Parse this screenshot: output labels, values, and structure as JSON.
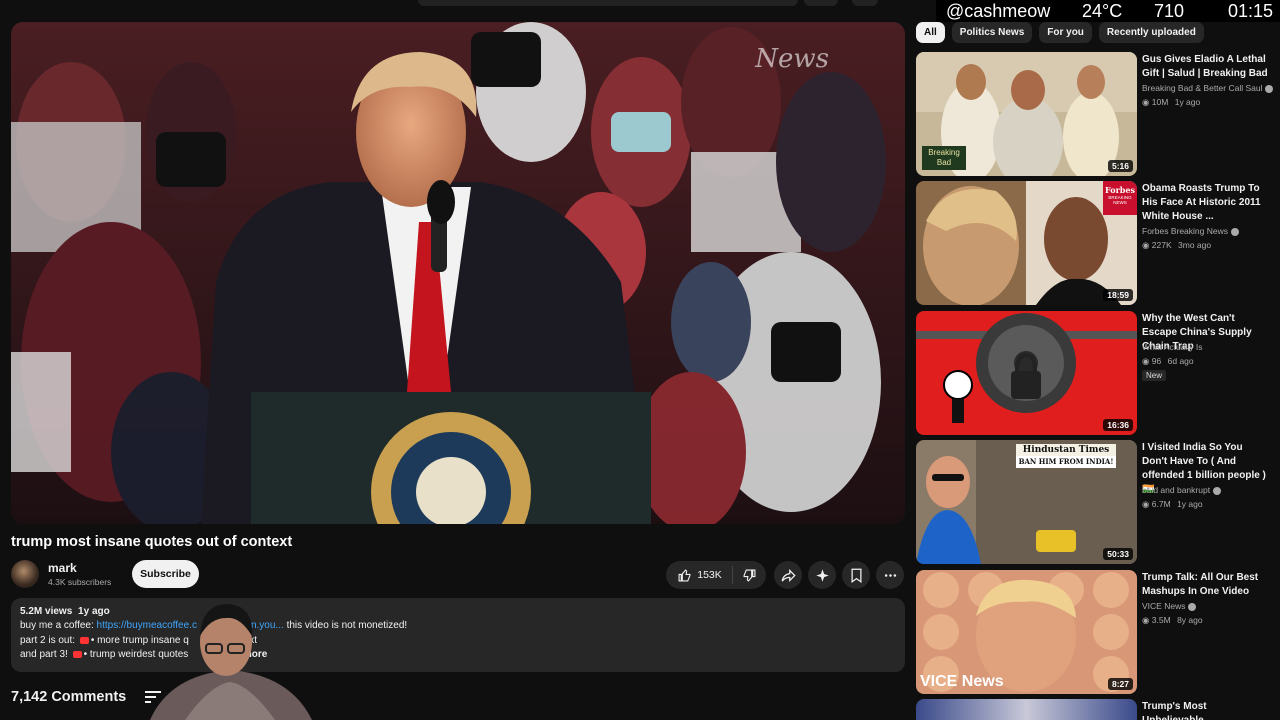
{
  "overlay": {
    "handle": "@cashmeow",
    "temp": "24°C",
    "count": "710",
    "time": "01:15"
  },
  "video": {
    "title": "trump most insane quotes out of context",
    "channel": "mark",
    "subscribers": "4.3K subscribers",
    "subscribe_label": "Subscribe",
    "likes": "153K",
    "watermark": "News"
  },
  "description": {
    "views": "5.2M views",
    "age": "1y ago",
    "line1_prefix": "buy me a coffee:",
    "line1_link": "https://buymeacoffee.c",
    "line1_link_tail": "n.you...",
    "line1_suffix": "this video is not monetized!",
    "line2_prefix": "part 2 is out:",
    "line2_text": "• more trump insane q",
    "line2_tail": "context",
    "line3_prefix": "and part 3!",
    "line3_text": "• trump weirdest quotes",
    "line3_tail": "xt",
    "more": "more"
  },
  "comments": {
    "count": "7,142 Comments"
  },
  "chips": [
    "All",
    "Politics News",
    "For you",
    "Recently uploaded"
  ],
  "recommendations": [
    {
      "title": "Gus Gives Eladio A Lethal Gift | Salud | Breaking Bad",
      "channel": "Breaking Bad & Better Call Saul",
      "verified": true,
      "views": "10M",
      "age": "1y ago",
      "duration": "5:16",
      "badge": ""
    },
    {
      "title": "Obama Roasts Trump To His Face At Historic 2011 White House ...",
      "channel": "Forbes Breaking News",
      "verified": true,
      "views": "227K",
      "age": "3mo ago",
      "duration": "18:59",
      "badge": ""
    },
    {
      "title": "Why the West Can't Escape China's Supply Chain Trap",
      "channel": "What Actually Is",
      "verified": false,
      "views": "96",
      "age": "6d ago",
      "duration": "16:36",
      "badge": "New"
    },
    {
      "title": "I Visited India So You Don't Have To ( And offended 1 billion people ) 🇮🇳",
      "channel": "bald and bankrupt",
      "verified": true,
      "views": "6.7M",
      "age": "1y ago",
      "duration": "50:33",
      "badge": ""
    },
    {
      "title": "Trump Talk: All Our Best Mashups In One Video",
      "channel": "VICE News",
      "verified": true,
      "views": "3.5M",
      "age": "8y ago",
      "duration": "8:27",
      "badge": ""
    },
    {
      "title": "Trump's Most Unbelievable",
      "channel": "",
      "verified": false,
      "views": "",
      "age": "",
      "duration": "",
      "badge": ""
    }
  ],
  "thumb_text": {
    "bb_logo": "Breaking Bad",
    "forbes": "Forbes",
    "forbes_sub": "BREAKING NEWS",
    "ht_paper": "Hindustan Times",
    "ht_headline": "BAN HIM FROM INDIA!",
    "vice": "VICE News"
  },
  "icons": {
    "like": "thumbs-up-icon",
    "dislike": "thumbs-down-icon",
    "share": "share-icon",
    "ai": "sparkle-icon",
    "save": "bookmark-icon",
    "more": "more-horizontal-icon",
    "sort": "sort-icon"
  }
}
